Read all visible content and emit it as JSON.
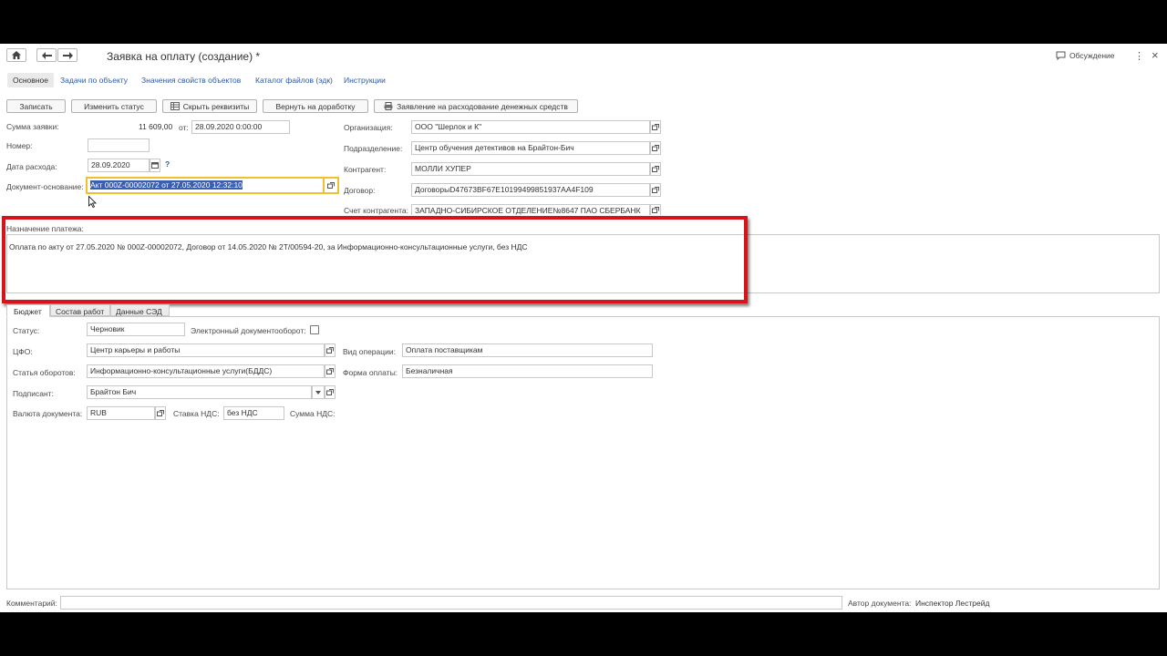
{
  "window": {
    "title": "Заявка на оплату (создание) *",
    "discuss_label": "Обсуждение",
    "more_icon": "⋮",
    "close_icon": "×"
  },
  "tabs": [
    {
      "label": "Основное"
    },
    {
      "label": "Задачи по объекту"
    },
    {
      "label": "Значения свойств объектов"
    },
    {
      "label": "Каталог файлов (эдк)"
    },
    {
      "label": "Инструкции"
    }
  ],
  "toolbar": {
    "save": "Записать",
    "change_status": "Изменить статус",
    "hide_requisites": "Скрыть реквизиты",
    "return_rework": "Вернуть на доработку",
    "statement": "Заявление на расходование денежных средств"
  },
  "form": {
    "amount_label": "Сумма заявки:",
    "amount_value": "11 609,00",
    "from_label": "от:",
    "from_value": "28.09.2020  0:00:00",
    "number_label": "Номер:",
    "number_value": "",
    "expense_date_label": "Дата расхода:",
    "expense_date_value": "28.09.2020",
    "help_mark": "?",
    "basis_label": "Документ-основание:",
    "basis_value": "Акт 000Z-00002072 от 27.05.2020 12:32:10",
    "org_label": "Организация:",
    "org_value": "ООО \"Шерлок и К\"",
    "division_label": "Подразделение:",
    "division_value": "Центр обучения детективов на Брайтон-Бич",
    "counterparty_label": "Контрагент:",
    "counterparty_value": "МОЛЛИ ХУПЕР",
    "contract_label": "Договор:",
    "contract_value": "ДоговорыD47673BF67E10199499851937AA4F109",
    "account_label": "Счет контрагента:",
    "account_value": "ЗАПАДНО-СИБИРСКОЕ ОТДЕЛЕНИЕ№8647 ПАО СБЕРБАНК"
  },
  "purpose": {
    "label": "Назначение платежа:",
    "text": "Оплата по акту от 27.05.2020 № 000Z-00002072, Договор от 14.05.2020 № 2Т/00594-20, за Информационно-консультационные услуги, без НДС"
  },
  "subtabs": [
    {
      "label": "Бюджет"
    },
    {
      "label": "Состав работ"
    },
    {
      "label": "Данные СЭД"
    }
  ],
  "budget": {
    "status_label": "Статус:",
    "status_value": "Черновик",
    "edo_label": "Электронный документооборот:",
    "cfo_label": "ЦФО:",
    "cfo_value": "Центр карьеры и работы",
    "op_kind_label": "Вид операции:",
    "op_kind_value": "Оплата поставщикам",
    "article_label": "Статья оборотов:",
    "article_value": "Информационно-консультационные услуги(БДДС)",
    "pay_form_label": "Форма оплаты:",
    "pay_form_value": "Безналичная",
    "signer_label": "Подписант:",
    "signer_value": "Брайтон Бич",
    "currency_label": "Валюта документа:",
    "currency_value": "RUB",
    "vat_rate_label": "Ставка НДС:",
    "vat_rate_value": "без НДС",
    "vat_sum_label": "Сумма НДС:"
  },
  "footer": {
    "comment_label": "Комментарий:",
    "comment_value": "",
    "author_label": "Автор документа:",
    "author_value": "Инспектор Лестрейд"
  },
  "highlight_color": "#d8141b"
}
